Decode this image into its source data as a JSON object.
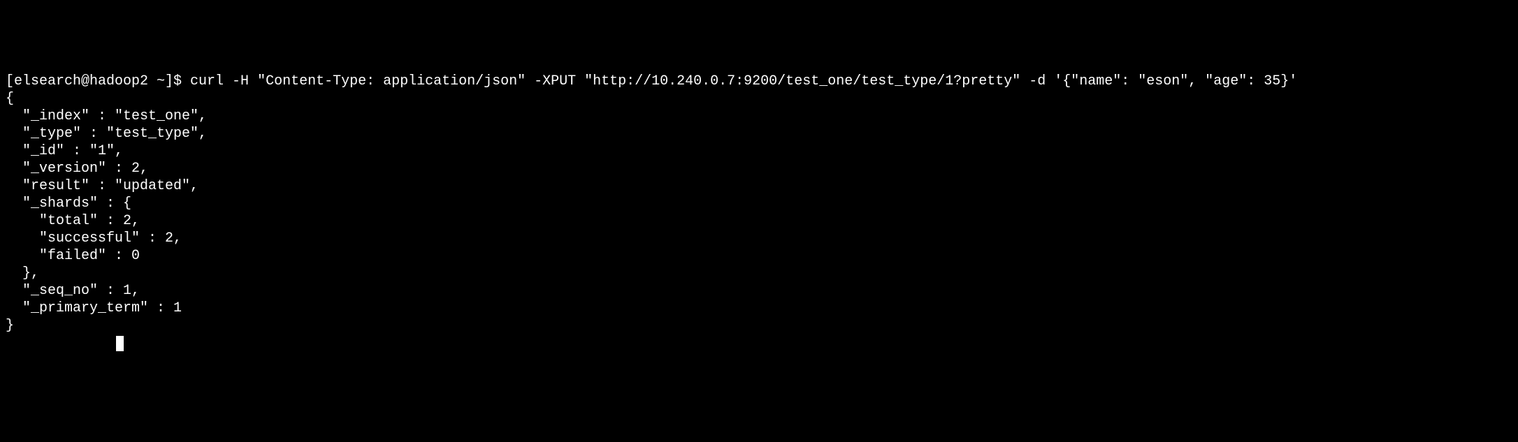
{
  "prompt": {
    "user_host": "[elsearch@hadoop2 ~]$ ",
    "command": "curl -H \"Content-Type: application/json\" -XPUT \"http://10.240.0.7:9200/test_one/test_type/1?pretty\" -d '{\"name\": \"eson\", \"age\": 35}'"
  },
  "output": {
    "line1": "{",
    "line2": "  \"_index\" : \"test_one\",",
    "line3": "  \"_type\" : \"test_type\",",
    "line4": "  \"_id\" : \"1\",",
    "line5": "  \"_version\" : 2,",
    "line6": "  \"result\" : \"updated\",",
    "line7": "  \"_shards\" : {",
    "line8": "    \"total\" : 2,",
    "line9": "    \"successful\" : 2,",
    "line10": "    \"failed\" : 0",
    "line11": "  },",
    "line12": "  \"_seq_no\" : 1,",
    "line13": "  \"_primary_term\" : 1",
    "line14": "}"
  }
}
